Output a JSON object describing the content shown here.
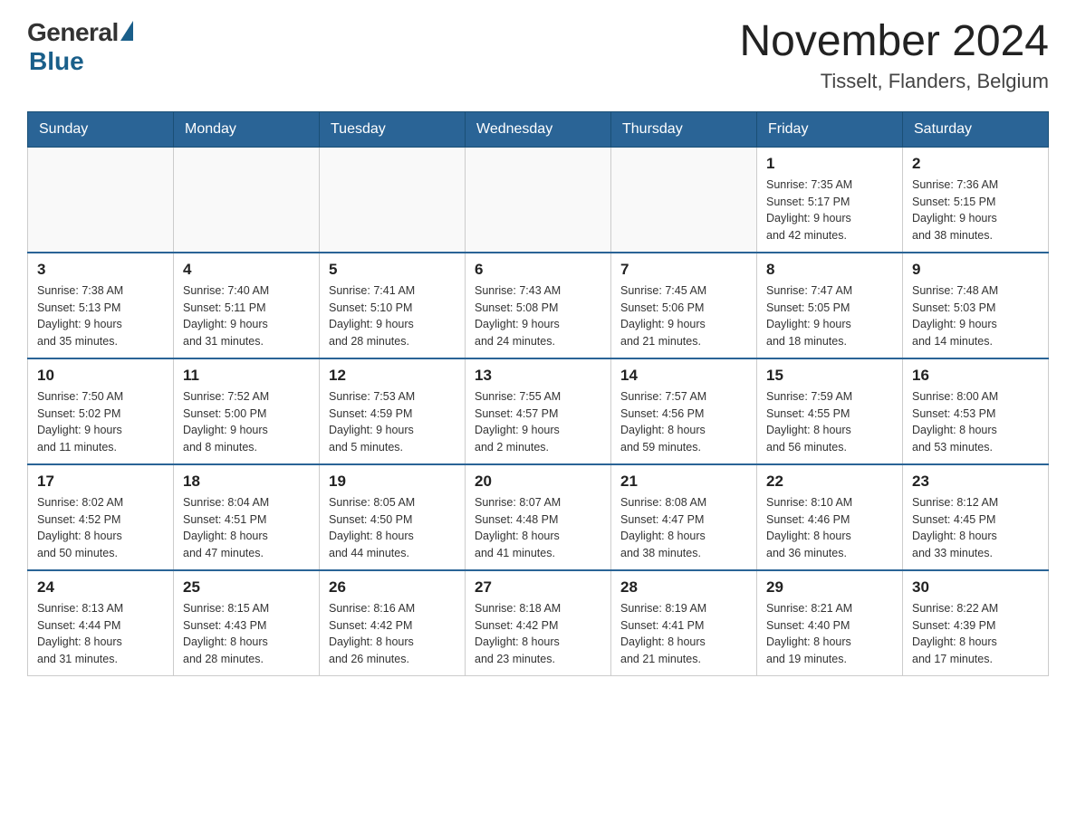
{
  "logo": {
    "general_text": "General",
    "blue_text": "Blue"
  },
  "title": {
    "month_year": "November 2024",
    "location": "Tisselt, Flanders, Belgium"
  },
  "headers": [
    "Sunday",
    "Monday",
    "Tuesday",
    "Wednesday",
    "Thursday",
    "Friday",
    "Saturday"
  ],
  "weeks": [
    [
      {
        "day": "",
        "info": ""
      },
      {
        "day": "",
        "info": ""
      },
      {
        "day": "",
        "info": ""
      },
      {
        "day": "",
        "info": ""
      },
      {
        "day": "",
        "info": ""
      },
      {
        "day": "1",
        "info": "Sunrise: 7:35 AM\nSunset: 5:17 PM\nDaylight: 9 hours\nand 42 minutes."
      },
      {
        "day": "2",
        "info": "Sunrise: 7:36 AM\nSunset: 5:15 PM\nDaylight: 9 hours\nand 38 minutes."
      }
    ],
    [
      {
        "day": "3",
        "info": "Sunrise: 7:38 AM\nSunset: 5:13 PM\nDaylight: 9 hours\nand 35 minutes."
      },
      {
        "day": "4",
        "info": "Sunrise: 7:40 AM\nSunset: 5:11 PM\nDaylight: 9 hours\nand 31 minutes."
      },
      {
        "day": "5",
        "info": "Sunrise: 7:41 AM\nSunset: 5:10 PM\nDaylight: 9 hours\nand 28 minutes."
      },
      {
        "day": "6",
        "info": "Sunrise: 7:43 AM\nSunset: 5:08 PM\nDaylight: 9 hours\nand 24 minutes."
      },
      {
        "day": "7",
        "info": "Sunrise: 7:45 AM\nSunset: 5:06 PM\nDaylight: 9 hours\nand 21 minutes."
      },
      {
        "day": "8",
        "info": "Sunrise: 7:47 AM\nSunset: 5:05 PM\nDaylight: 9 hours\nand 18 minutes."
      },
      {
        "day": "9",
        "info": "Sunrise: 7:48 AM\nSunset: 5:03 PM\nDaylight: 9 hours\nand 14 minutes."
      }
    ],
    [
      {
        "day": "10",
        "info": "Sunrise: 7:50 AM\nSunset: 5:02 PM\nDaylight: 9 hours\nand 11 minutes."
      },
      {
        "day": "11",
        "info": "Sunrise: 7:52 AM\nSunset: 5:00 PM\nDaylight: 9 hours\nand 8 minutes."
      },
      {
        "day": "12",
        "info": "Sunrise: 7:53 AM\nSunset: 4:59 PM\nDaylight: 9 hours\nand 5 minutes."
      },
      {
        "day": "13",
        "info": "Sunrise: 7:55 AM\nSunset: 4:57 PM\nDaylight: 9 hours\nand 2 minutes."
      },
      {
        "day": "14",
        "info": "Sunrise: 7:57 AM\nSunset: 4:56 PM\nDaylight: 8 hours\nand 59 minutes."
      },
      {
        "day": "15",
        "info": "Sunrise: 7:59 AM\nSunset: 4:55 PM\nDaylight: 8 hours\nand 56 minutes."
      },
      {
        "day": "16",
        "info": "Sunrise: 8:00 AM\nSunset: 4:53 PM\nDaylight: 8 hours\nand 53 minutes."
      }
    ],
    [
      {
        "day": "17",
        "info": "Sunrise: 8:02 AM\nSunset: 4:52 PM\nDaylight: 8 hours\nand 50 minutes."
      },
      {
        "day": "18",
        "info": "Sunrise: 8:04 AM\nSunset: 4:51 PM\nDaylight: 8 hours\nand 47 minutes."
      },
      {
        "day": "19",
        "info": "Sunrise: 8:05 AM\nSunset: 4:50 PM\nDaylight: 8 hours\nand 44 minutes."
      },
      {
        "day": "20",
        "info": "Sunrise: 8:07 AM\nSunset: 4:48 PM\nDaylight: 8 hours\nand 41 minutes."
      },
      {
        "day": "21",
        "info": "Sunrise: 8:08 AM\nSunset: 4:47 PM\nDaylight: 8 hours\nand 38 minutes."
      },
      {
        "day": "22",
        "info": "Sunrise: 8:10 AM\nSunset: 4:46 PM\nDaylight: 8 hours\nand 36 minutes."
      },
      {
        "day": "23",
        "info": "Sunrise: 8:12 AM\nSunset: 4:45 PM\nDaylight: 8 hours\nand 33 minutes."
      }
    ],
    [
      {
        "day": "24",
        "info": "Sunrise: 8:13 AM\nSunset: 4:44 PM\nDaylight: 8 hours\nand 31 minutes."
      },
      {
        "day": "25",
        "info": "Sunrise: 8:15 AM\nSunset: 4:43 PM\nDaylight: 8 hours\nand 28 minutes."
      },
      {
        "day": "26",
        "info": "Sunrise: 8:16 AM\nSunset: 4:42 PM\nDaylight: 8 hours\nand 26 minutes."
      },
      {
        "day": "27",
        "info": "Sunrise: 8:18 AM\nSunset: 4:42 PM\nDaylight: 8 hours\nand 23 minutes."
      },
      {
        "day": "28",
        "info": "Sunrise: 8:19 AM\nSunset: 4:41 PM\nDaylight: 8 hours\nand 21 minutes."
      },
      {
        "day": "29",
        "info": "Sunrise: 8:21 AM\nSunset: 4:40 PM\nDaylight: 8 hours\nand 19 minutes."
      },
      {
        "day": "30",
        "info": "Sunrise: 8:22 AM\nSunset: 4:39 PM\nDaylight: 8 hours\nand 17 minutes."
      }
    ]
  ]
}
